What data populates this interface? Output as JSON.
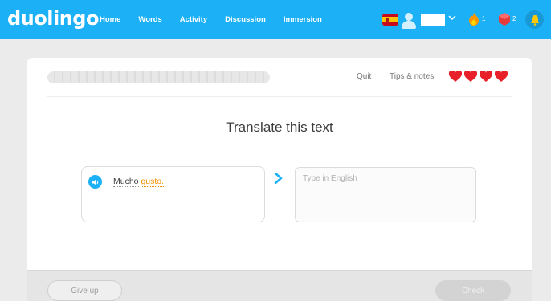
{
  "app": {
    "logo": "duolingo"
  },
  "nav": {
    "items": [
      {
        "label": "Home"
      },
      {
        "label": "Words"
      },
      {
        "label": "Activity"
      },
      {
        "label": "Discussion"
      },
      {
        "label": "Immersion"
      }
    ]
  },
  "user": {
    "language_flag_icon": "spain-flag-icon",
    "avatar_icon": "user-avatar-icon",
    "streak_count": "1",
    "gem_count": "2",
    "notifications_icon": "bell-icon"
  },
  "lesson": {
    "progress_fraction": 0,
    "quit_label": "Quit",
    "tips_label": "Tips & notes",
    "hearts_remaining": 4,
    "prompt": "Translate this text",
    "source_words": [
      "Mucho",
      "gusto."
    ],
    "answer_value": "",
    "answer_placeholder": "Type in English"
  },
  "footer": {
    "give_up_label": "Give up",
    "check_label": "Check"
  },
  "colors": {
    "brand_blue": "#1cb0f6",
    "heart_red": "#e8202a",
    "highlight_orange": "#f49000"
  }
}
